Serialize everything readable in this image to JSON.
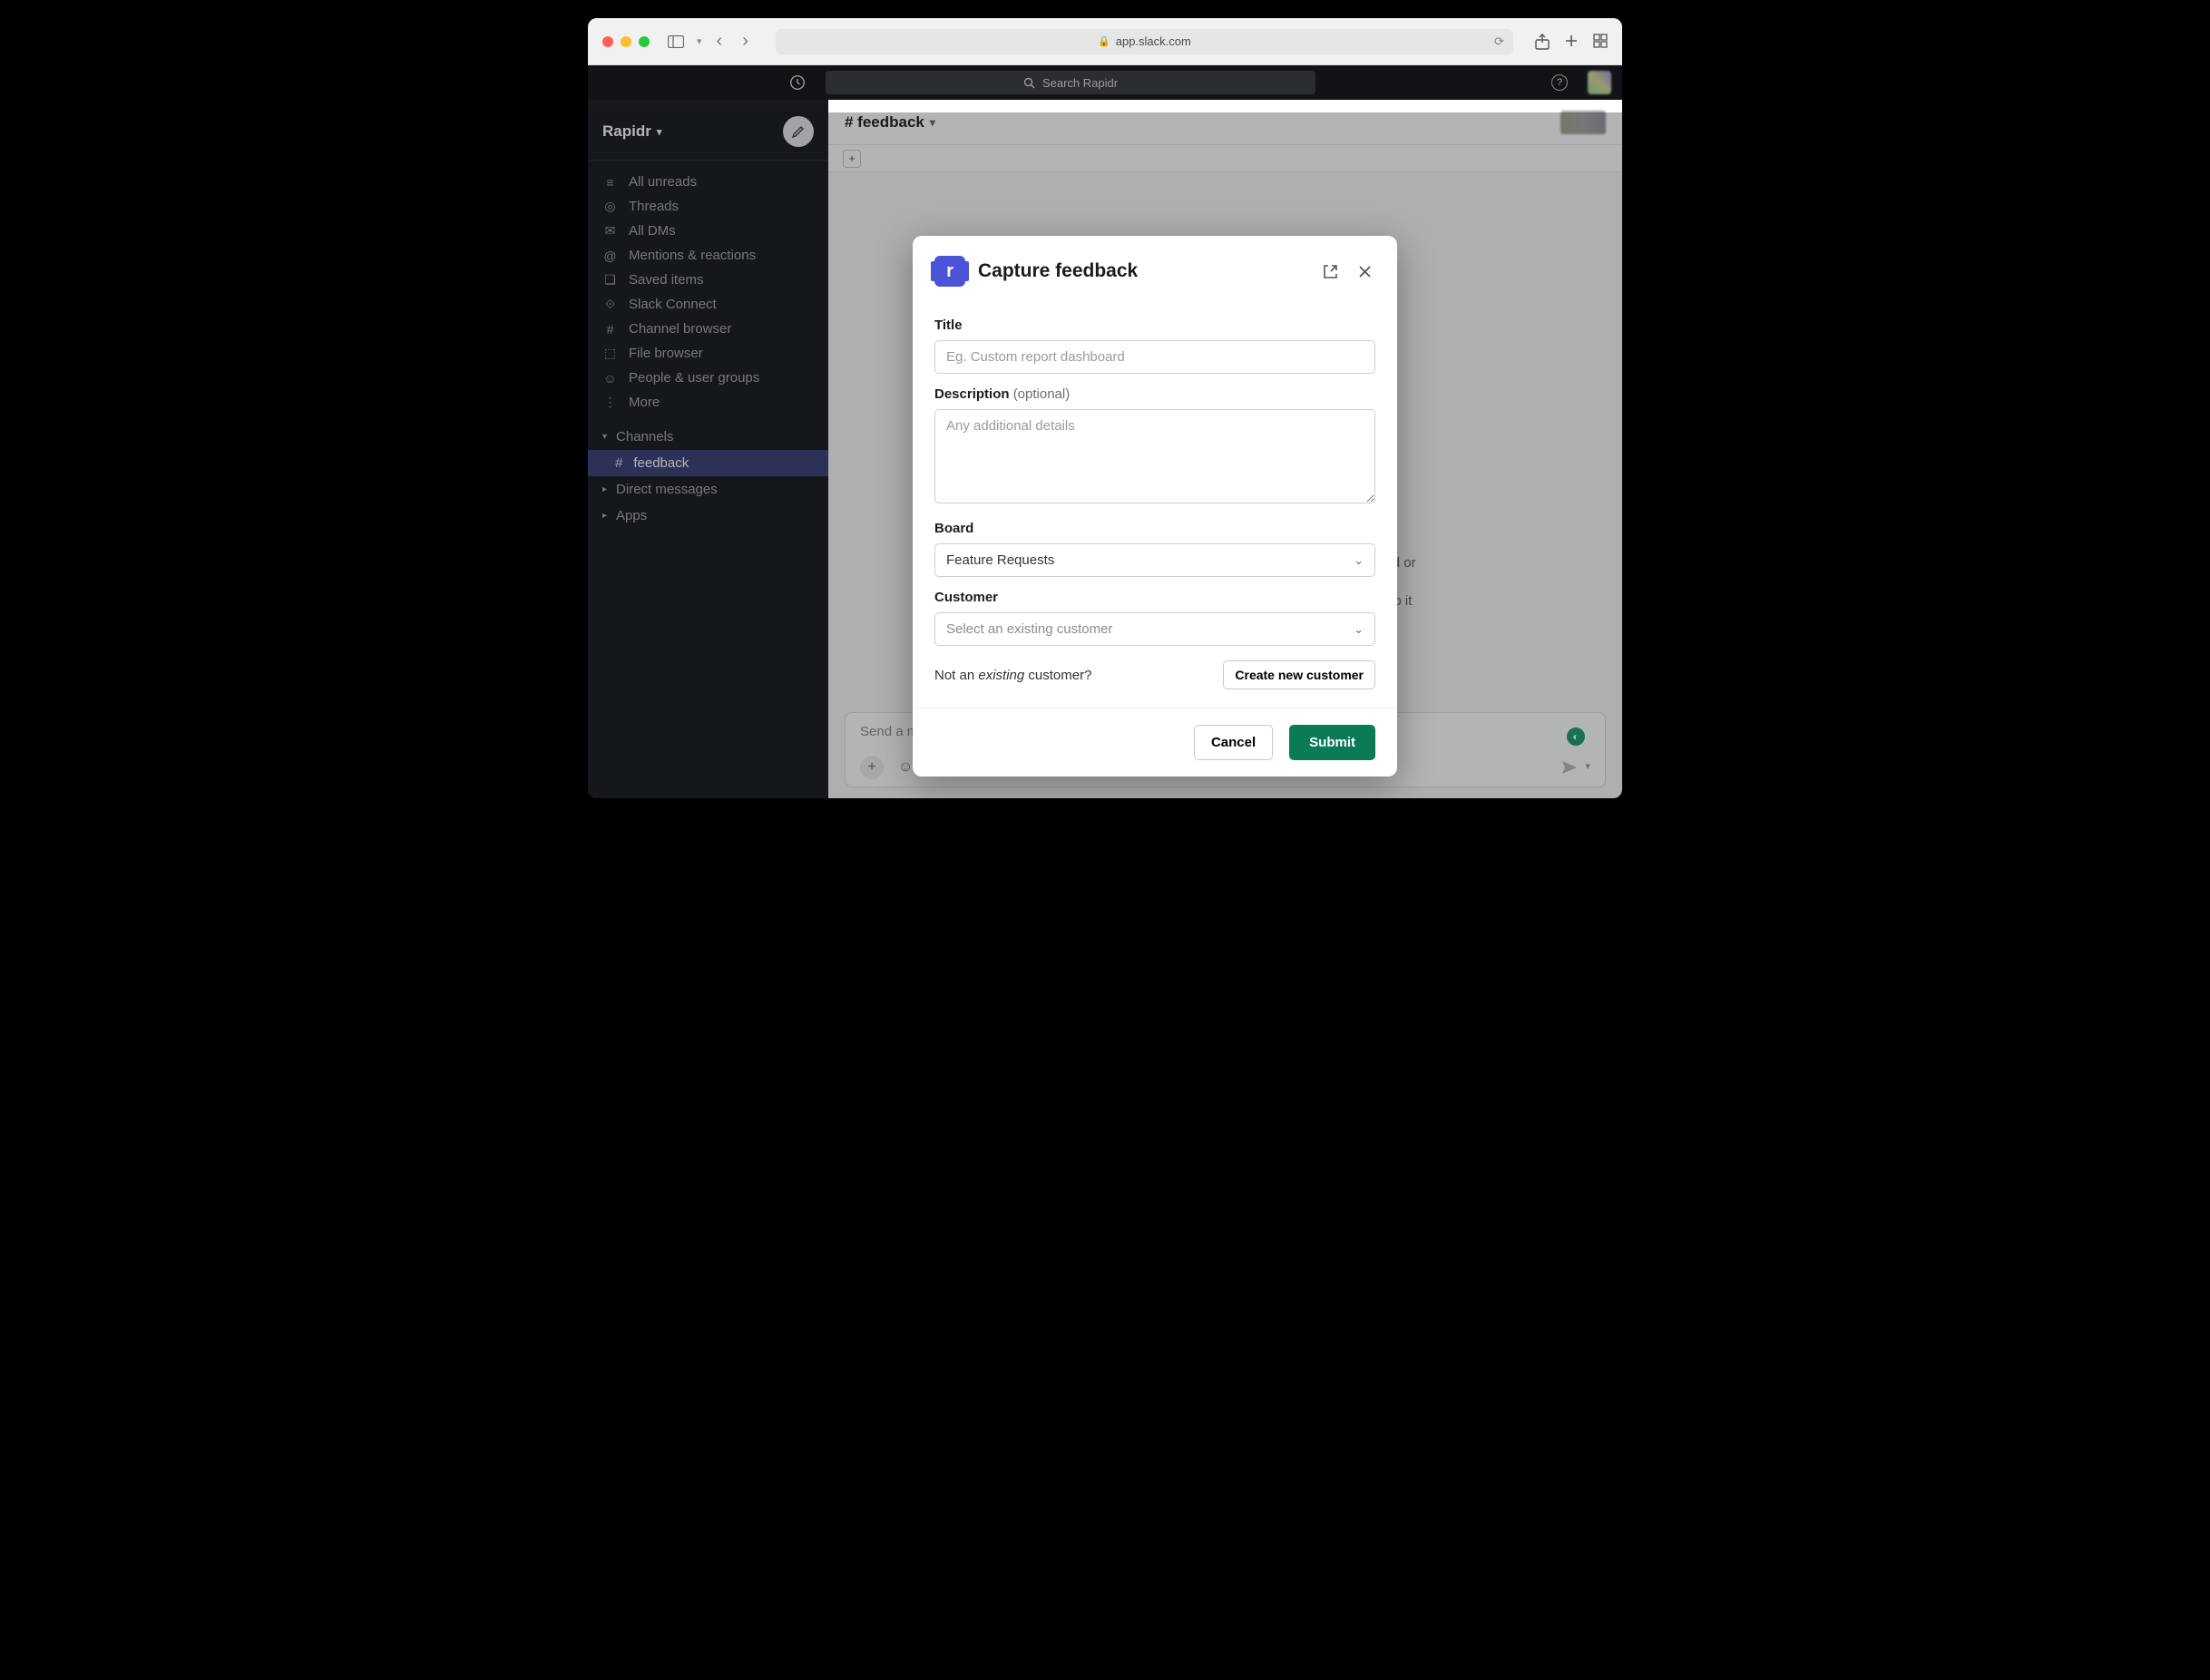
{
  "browser": {
    "url": "app.slack.com"
  },
  "slack": {
    "search_placeholder": "Search Rapidr",
    "workspace": "Rapidr",
    "nav": {
      "all_unreads": "All unreads",
      "threads": "Threads",
      "all_dms": "All DMs",
      "mentions": "Mentions & reactions",
      "saved": "Saved items",
      "connect": "Slack Connect",
      "channel_browser": "Channel browser",
      "file_browser": "File browser",
      "people": "People & user groups",
      "more": "More"
    },
    "sections": {
      "channels": "Channels",
      "dms": "Direct messages",
      "apps": "Apps"
    },
    "active_channel": "feedback",
    "channel_header": "# feedback",
    "composer_placeholder": "Send a message to #feedback",
    "bg_line1": "idental reload or",
    "bg_line2": "in-session, so it"
  },
  "modal": {
    "title": "Capture feedback",
    "app_letter": "r",
    "fields": {
      "title_label": "Title",
      "title_placeholder": "Eg. Custom report dashboard",
      "desc_label": "Description",
      "desc_optional": "(optional)",
      "desc_placeholder": "Any additional details",
      "board_label": "Board",
      "board_value": "Feature Requests",
      "customer_label": "Customer",
      "customer_placeholder": "Select an existing customer"
    },
    "not_existing_prefix": "Not an ",
    "not_existing_em": "existing",
    "not_existing_suffix": " customer?",
    "create_customer": "Create new customer",
    "cancel": "Cancel",
    "submit": "Submit"
  }
}
